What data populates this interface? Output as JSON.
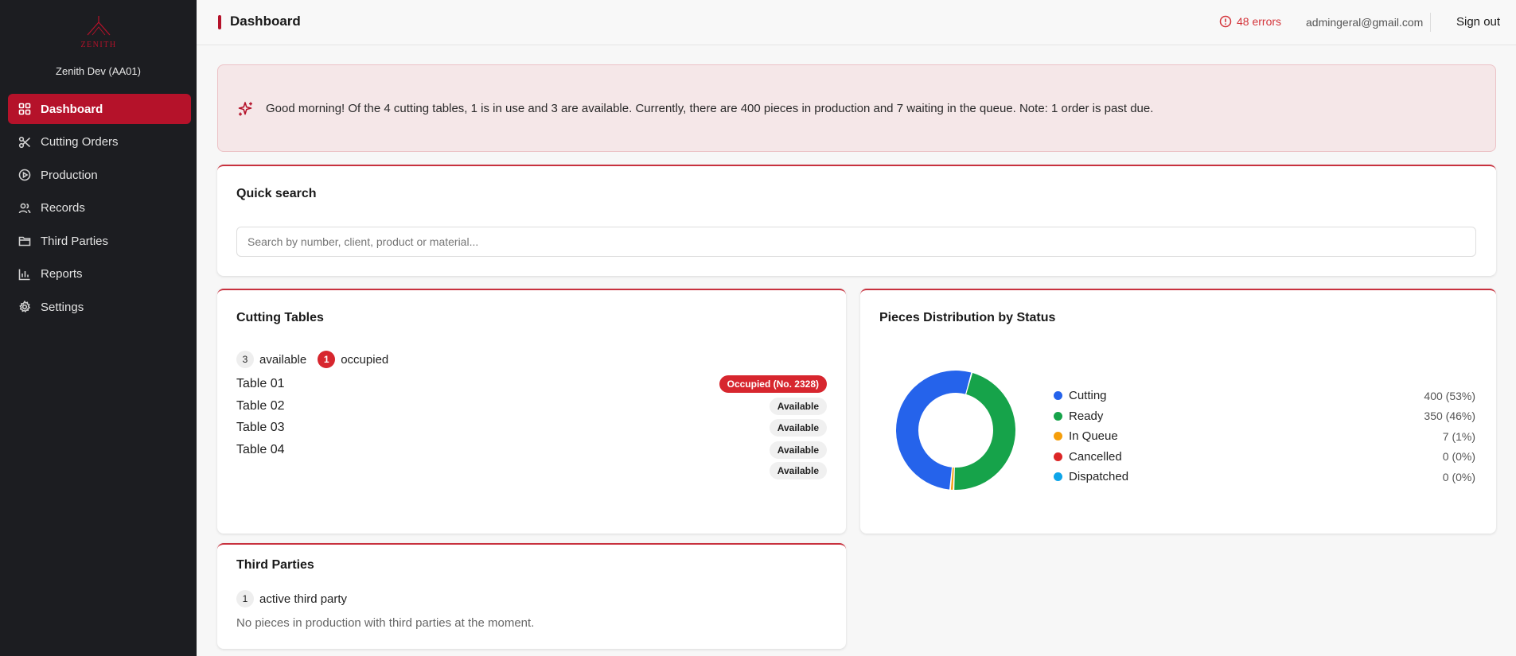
{
  "sidebar": {
    "logo_text": "ZENITH",
    "org": "Zenith Dev (AA01)",
    "items": [
      {
        "label": "Dashboard",
        "icon": "grid-icon",
        "active": true
      },
      {
        "label": "Cutting Orders",
        "icon": "scissors-icon"
      },
      {
        "label": "Production",
        "icon": "play-circle-icon"
      },
      {
        "label": "Records",
        "icon": "users-icon"
      },
      {
        "label": "Third Parties",
        "icon": "folder-icon"
      },
      {
        "label": "Reports",
        "icon": "bar-chart-icon"
      },
      {
        "label": "Settings",
        "icon": "gear-icon"
      }
    ]
  },
  "header": {
    "title": "Dashboard",
    "errors": "48 errors",
    "email": "admingeral@gmail.com",
    "signout": "Sign out"
  },
  "banner": {
    "message": "Good morning! Of the 4 cutting tables, 1 is in use and 3 are available. Currently, there are 400 pieces in production and 7 waiting in the queue. Note: 1 order is past due."
  },
  "search": {
    "title": "Quick search",
    "placeholder": "Search by number, client, product or material..."
  },
  "tables": {
    "title": "Cutting Tables",
    "available_count": "3",
    "available_label": "available",
    "occupied_count": "1",
    "occupied_label": "occupied",
    "rows": [
      {
        "name": "Table 01",
        "status": "Occupied (No. 2328)"
      },
      {
        "name": "Table 02",
        "status": "Available"
      },
      {
        "name": "Table 03",
        "status": "Available"
      },
      {
        "name": "Table 04",
        "status": "Available"
      }
    ],
    "extra_badge": "Available"
  },
  "distribution": {
    "title": "Pieces Distribution by Status",
    "items": [
      {
        "name": "Cutting",
        "value": "400 (53%)",
        "color": "#2563eb"
      },
      {
        "name": "Ready",
        "value": "350 (46%)",
        "color": "#16a34a"
      },
      {
        "name": "In Queue",
        "value": "7 (1%)",
        "color": "#f59e0b"
      },
      {
        "name": "Cancelled",
        "value": "0 (0%)",
        "color": "#dc2626"
      },
      {
        "name": "Dispatched",
        "value": "0 (0%)",
        "color": "#0ea5e9"
      }
    ]
  },
  "chart_data": {
    "type": "pie",
    "title": "Pieces Distribution by Status",
    "categories": [
      "Cutting",
      "Ready",
      "In Queue",
      "Cancelled",
      "Dispatched"
    ],
    "values": [
      400,
      350,
      7,
      0,
      0
    ],
    "colors": [
      "#2563eb",
      "#16a34a",
      "#f59e0b",
      "#dc2626",
      "#0ea5e9"
    ],
    "legend": "right"
  },
  "third_parties": {
    "title": "Third Parties",
    "count": "1",
    "count_label": "active third party",
    "message": "No pieces in production with third parties at the moment."
  }
}
